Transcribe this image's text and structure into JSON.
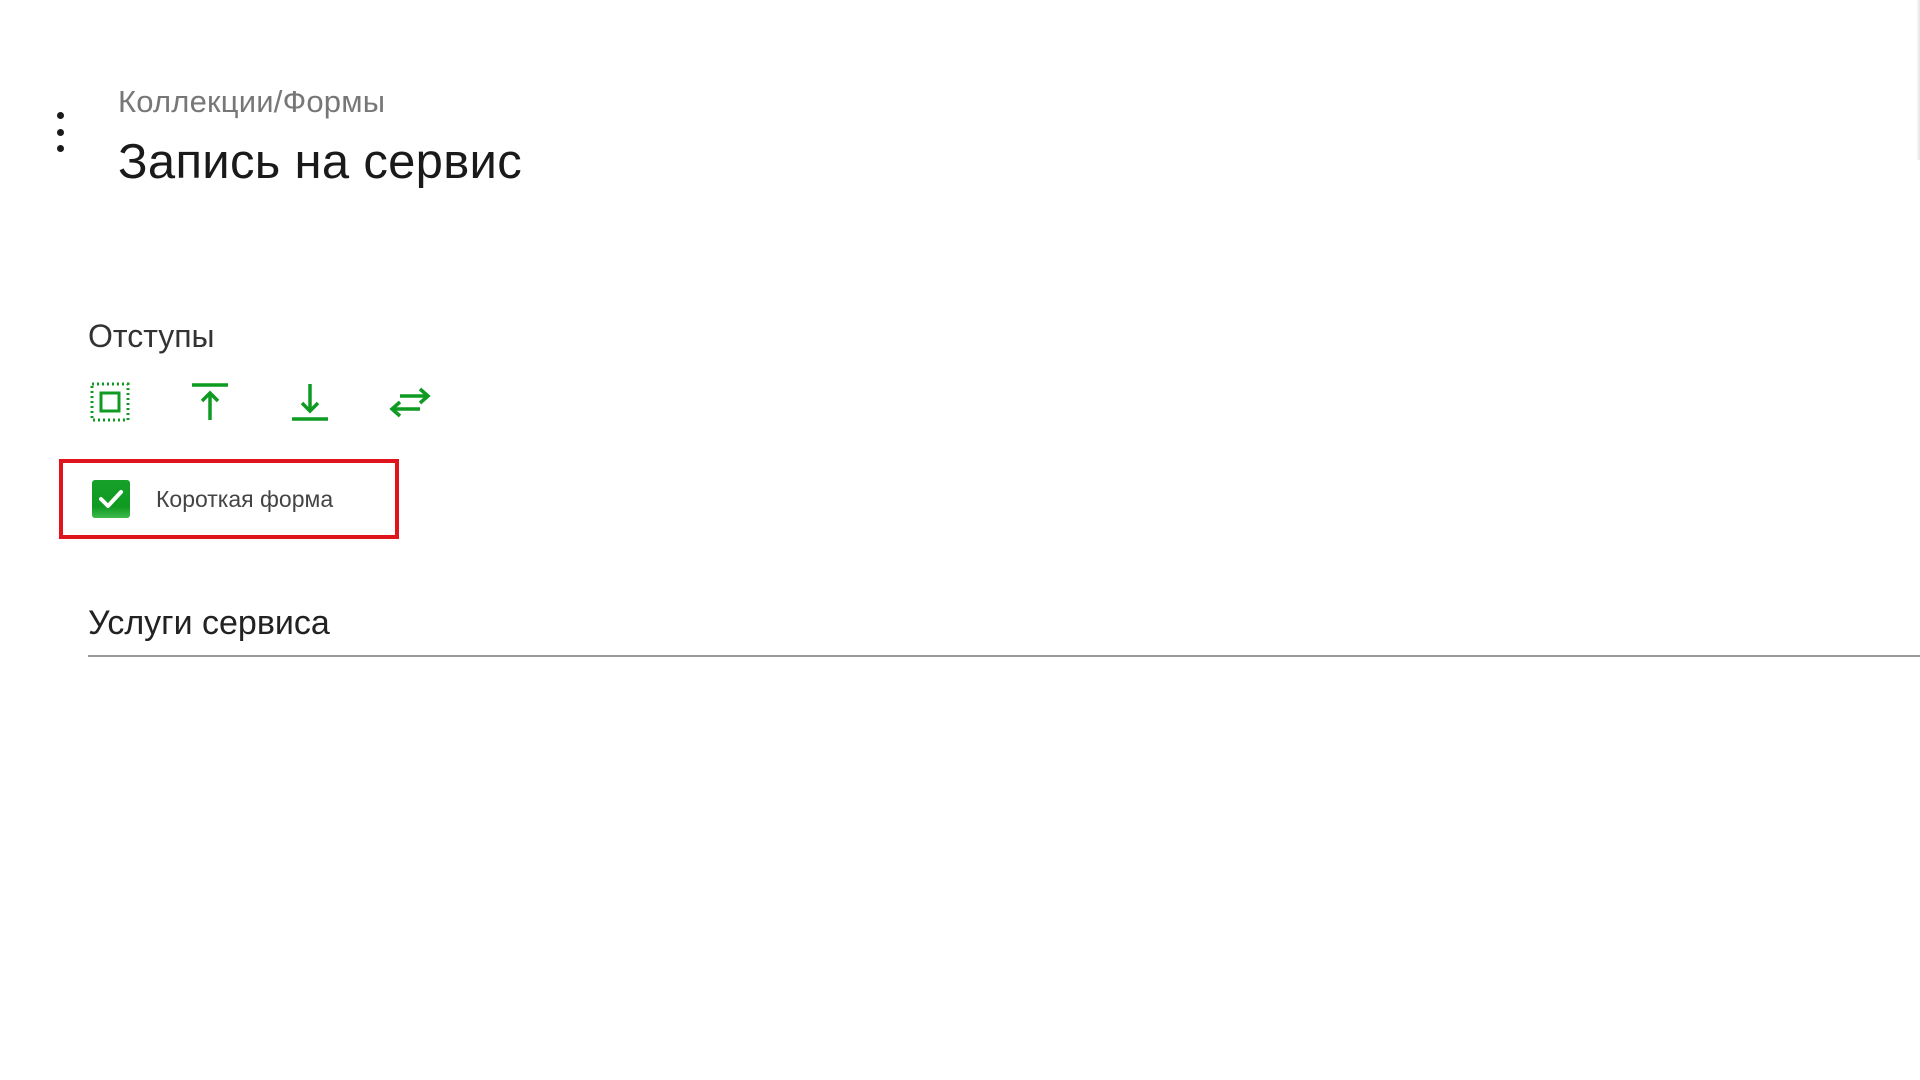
{
  "header": {
    "breadcrumb": "Коллекции/Формы",
    "title": "Запись на сервис"
  },
  "padding_section": {
    "label": "Отступы",
    "tools": [
      {
        "name": "padding-all-icon"
      },
      {
        "name": "padding-top-icon"
      },
      {
        "name": "padding-bottom-icon"
      },
      {
        "name": "padding-horizontal-icon"
      }
    ]
  },
  "short_form": {
    "label": "Короткая форма",
    "checked": true
  },
  "services": {
    "title": "Услуги сервиса"
  },
  "colors": {
    "accent": "#0f9a22",
    "highlight": "#e0141c"
  }
}
